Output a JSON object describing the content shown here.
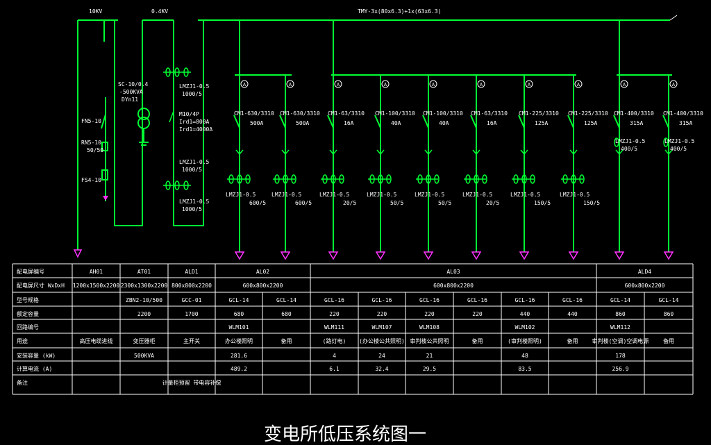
{
  "bus": {
    "hv_label": "10KV",
    "lv_label": "0.4KV",
    "main_label": "TMY-3x(80x6.3)+1x(63x6.3)"
  },
  "hv_side": {
    "transformer_label": [
      "SC-10/0.4",
      "-500KVA",
      "DYn11"
    ],
    "fn_label": "FN5-10",
    "rn_label": [
      "RN5-10",
      "50/50"
    ],
    "fs_label": "FS4-10"
  },
  "incoming": {
    "ct_top": [
      "LMZJ1-0.5",
      "1000/5"
    ],
    "breaker": [
      "M10/4P",
      "Ird1=800A",
      "Ird1=4000A"
    ],
    "ct_mid": [
      "LMZJ1-0.5",
      "1000/5"
    ],
    "ct_bottom": [
      "LMZJ1-0.5",
      "1000/5"
    ]
  },
  "feeders": [
    {
      "cm": "CM1-630/3310",
      "amp": "500A",
      "ct": "LMZJ1-0.5",
      "ratio": "600/5"
    },
    {
      "cm": "CM1-630/3310",
      "amp": "500A",
      "ct": "LMZJ1-0.5",
      "ratio": "600/5"
    },
    {
      "cm": "CM1-63/3310",
      "amp": "16A",
      "ct": "LMZJ1-0.5",
      "ratio": "20/5"
    },
    {
      "cm": "CM1-100/3310",
      "amp": "40A",
      "ct": "LMZJ1-0.5",
      "ratio": "50/5"
    },
    {
      "cm": "CM1-100/3310",
      "amp": "40A",
      "ct": "LMZJ1-0.5",
      "ratio": "50/5"
    },
    {
      "cm": "CM1-63/3310",
      "amp": "16A",
      "ct": "LMZJ1-0.5",
      "ratio": "20/5"
    },
    {
      "cm": "CM1-225/3310",
      "amp": "125A",
      "ct": "LMZJ1-0.5",
      "ratio": "150/5"
    },
    {
      "cm": "CM1-225/3310",
      "amp": "125A",
      "ct": "LMZJ1-0.5",
      "ratio": "150/5"
    },
    {
      "cm": "CM1-400/3310",
      "amp": "315A",
      "ct": "LMZJ1-0.5",
      "ratio": "400/5"
    },
    {
      "cm": "CM1-400/3310",
      "amp": "315A",
      "ct": "LMZJ1-0.5",
      "ratio": "400/5"
    }
  ],
  "table": {
    "row_headers": [
      "配电屏编号",
      "配电屏尺寸 WxDxH",
      "型号规格",
      "额定容量",
      "回路编号",
      "用途",
      "安装容量 (kW)",
      "计算电流 (A)",
      "备注"
    ],
    "panels": [
      "AH01",
      "AT01",
      "ALD1",
      "AL02",
      "AL03",
      "ALD4"
    ],
    "sizes": [
      "1200x1500x2200",
      "2300x1300x2200",
      "800x800x2200",
      "600x800x2200",
      "600x800x2200",
      "600x800x2200"
    ],
    "models": [
      "",
      "ZBN2-10/500",
      "GCC-01",
      "GCL-14",
      "GCL-14",
      "GCL-16",
      "GCL-16",
      "GCL-16",
      "GCL-16",
      "GCL-16",
      "GCL-16",
      "GCL-14",
      "GCL-14"
    ],
    "rated": [
      "",
      "2200",
      "1700",
      "680",
      "680",
      "220",
      "220",
      "220",
      "220",
      "440",
      "440",
      "860",
      "860"
    ],
    "circuits": [
      "",
      "",
      "",
      "WLM101",
      "",
      "WLM111",
      "WLM107",
      "WLM108",
      "",
      "WLM102",
      "",
      "WLM112",
      ""
    ],
    "uses": [
      "高压电缆进线",
      "变压器柜",
      "主开关",
      "办公楼照明",
      "备用",
      "(路灯电)",
      "(办公楼公共照明)",
      "审判楼公共照明",
      "备用",
      "(审判楼照明)",
      "备用",
      "审判楼(空调)空调电源",
      "备用"
    ],
    "install_kw": [
      "",
      "500KVA",
      "",
      "281.6",
      "",
      "4",
      "24",
      "21",
      "",
      "48",
      "",
      "178",
      ""
    ],
    "calc_a": [
      "",
      "",
      "",
      "489.2",
      "",
      "6.1",
      "32.4",
      "29.5",
      "",
      "83.5",
      "",
      "256.9",
      ""
    ],
    "remarks": [
      "",
      "",
      "计量柜预留 带电容补偿",
      "",
      "",
      "",
      "",
      "",
      "",
      "",
      "",
      "",
      ""
    ]
  },
  "title": "变电所低压系统图一",
  "colors": {
    "line": "#00ff33",
    "text": "#ffffff",
    "table": "#ffffff",
    "arrow": "#ff33ff",
    "background": "#000000"
  }
}
